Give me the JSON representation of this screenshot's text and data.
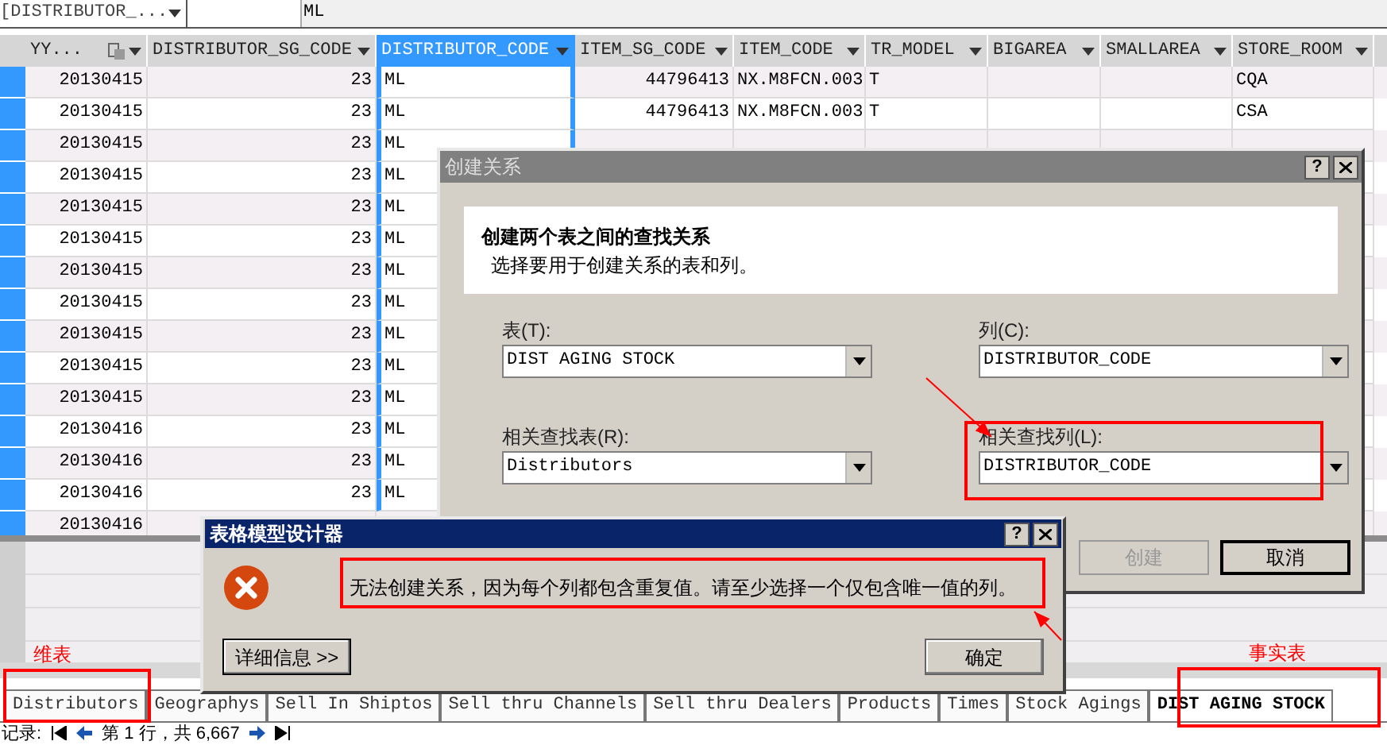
{
  "formula_bar": {
    "name_box": "[DISTRIBUTOR_...",
    "value": "ML"
  },
  "grid": {
    "columns": [
      {
        "label": "YY...",
        "selected": false
      },
      {
        "label": "DISTRIBUTOR_SG_CODE",
        "selected": false
      },
      {
        "label": "DISTRIBUTOR_CODE",
        "selected": true
      },
      {
        "label": "ITEM_SG_CODE",
        "selected": false
      },
      {
        "label": "ITEM_CODE",
        "selected": false
      },
      {
        "label": "TR_MODEL",
        "selected": false
      },
      {
        "label": "BIGAREA",
        "selected": false
      },
      {
        "label": "SMALLAREA",
        "selected": false
      },
      {
        "label": "STORE_ROOM",
        "selected": false
      }
    ],
    "rows": [
      [
        "20130415",
        "23",
        "ML",
        "44796413",
        "NX.M8FCN.003",
        "T",
        "",
        "",
        "CQA"
      ],
      [
        "20130415",
        "23",
        "ML",
        "44796413",
        "NX.M8FCN.003",
        "T",
        "",
        "",
        "CSA"
      ],
      [
        "20130415",
        "23",
        "ML"
      ],
      [
        "20130415",
        "23",
        "ML"
      ],
      [
        "20130415",
        "23",
        "ML"
      ],
      [
        "20130415",
        "23",
        "ML"
      ],
      [
        "20130415",
        "23",
        "ML"
      ],
      [
        "20130415",
        "23",
        "ML"
      ],
      [
        "20130415",
        "23",
        "ML"
      ],
      [
        "20130415",
        "23",
        "ML"
      ],
      [
        "20130415",
        "23",
        "ML"
      ],
      [
        "20130416",
        "23",
        "ML"
      ],
      [
        "20130416",
        "23",
        "ML"
      ],
      [
        "20130416",
        "23",
        "ML"
      ],
      [
        "20130416"
      ]
    ]
  },
  "sheet_tabs": [
    {
      "label": "Distributors",
      "selected": false
    },
    {
      "label": "Geographys",
      "selected": false
    },
    {
      "label": "Sell In Shiptos",
      "selected": false
    },
    {
      "label": "Sell thru Channels",
      "selected": false
    },
    {
      "label": "Sell thru Dealers",
      "selected": false
    },
    {
      "label": "Products",
      "selected": false
    },
    {
      "label": "Times",
      "selected": false
    },
    {
      "label": "Stock Agings",
      "selected": false
    },
    {
      "label": "DIST AGING STOCK",
      "selected": true
    }
  ],
  "record_nav": {
    "label": "记录:",
    "position": "第 1 行，共 6,667"
  },
  "create_dialog": {
    "title": "创建关系",
    "help_button": "?",
    "heading": "创建两个表之间的查找关系",
    "description": "选择要用于创建关系的表和列。",
    "fields": [
      {
        "label": "表(T):",
        "value": "DIST AGING STOCK"
      },
      {
        "label": "列(C):",
        "value": "DISTRIBUTOR_CODE"
      },
      {
        "label": "相关查找表(R):",
        "value": "Distributors"
      },
      {
        "label": "相关查找列(L):",
        "value": "DISTRIBUTOR_CODE"
      }
    ],
    "buttons": [
      {
        "label": "创建",
        "disabled": true
      },
      {
        "label": "取消",
        "disabled": false
      }
    ]
  },
  "error_dialog": {
    "title": "表格模型设计器",
    "help_button": "?",
    "message": "无法创建关系，因为每个列都包含重复值。请至少选择一个仅包含唯一值的列。",
    "details_button": "详细信息 >>",
    "ok_button": "确定"
  },
  "annotations": [
    {
      "text": "维表"
    },
    {
      "text": "事实表"
    }
  ]
}
